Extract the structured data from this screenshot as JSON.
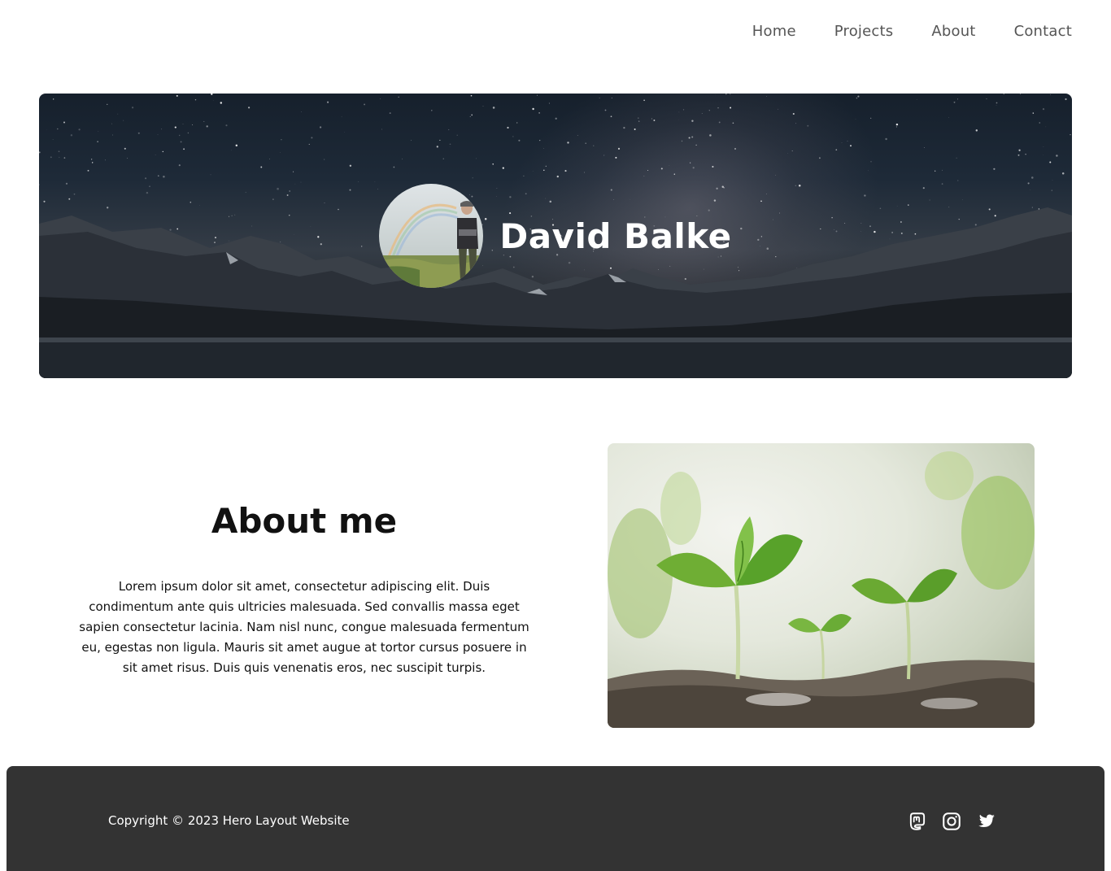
{
  "nav": {
    "items": [
      {
        "label": "Home"
      },
      {
        "label": "Projects"
      },
      {
        "label": "About"
      },
      {
        "label": "Contact"
      }
    ]
  },
  "hero": {
    "title": "David Balke",
    "avatar_alt": "profile photo"
  },
  "about": {
    "title": "About me",
    "body": "Lorem ipsum dolor sit amet, consectetur adipiscing elit. Duis condimentum ante quis ultricies malesuada. Sed convallis massa eget sapien consectetur lacinia. Nam nisl nunc, congue malesuada fermentum eu, egestas non ligula. Mauris sit amet augue at tortor cursus posuere in sit amet risus. Duis quis venenatis eros, nec suscipit turpis."
  },
  "footer": {
    "copyright": "Copyright © 2023 Hero Layout Website",
    "socials": [
      {
        "icon": "mastodon-icon"
      },
      {
        "icon": "instagram-icon"
      },
      {
        "icon": "twitter-icon"
      }
    ]
  },
  "colors": {
    "footer_bg": "#333333",
    "nav_text": "#555555",
    "hero_title": "#ffffff"
  }
}
